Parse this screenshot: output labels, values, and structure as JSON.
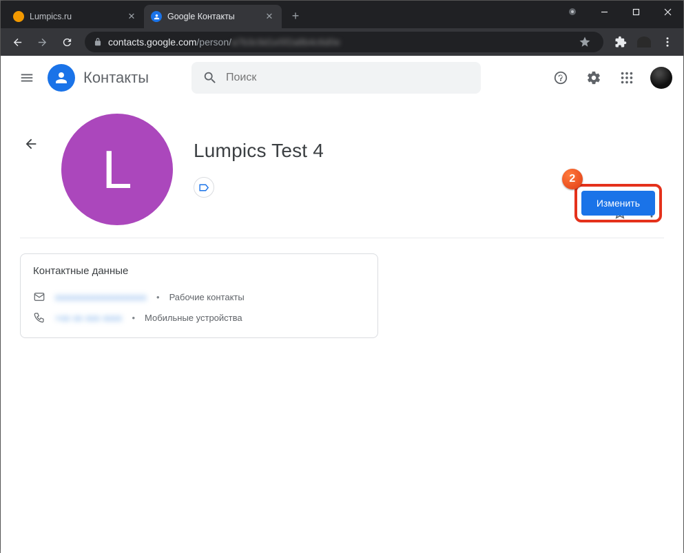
{
  "browser": {
    "tabs": [
      {
        "label": "Lumpics.ru",
        "active": false
      },
      {
        "label": "Google Контакты",
        "active": true
      }
    ],
    "url_host": "contacts.google.com",
    "url_path": "/person/",
    "url_obscured": "a7b3c9d1e5f2a8b4c6d0e"
  },
  "app": {
    "title": "Контакты",
    "search_placeholder": "Поиск"
  },
  "contact": {
    "name": "Lumpics Test 4",
    "initial": "L",
    "edit_label": "Изменить",
    "details_title": "Контактные данные",
    "email": {
      "value": "xxxxxxxxxxxxxxxxxxx",
      "tag": "Рабочие контакты"
    },
    "phone": {
      "value": "+xx xx xxx xxxx",
      "tag": "Мобильные устройства"
    }
  },
  "annotation": {
    "number": "2"
  }
}
